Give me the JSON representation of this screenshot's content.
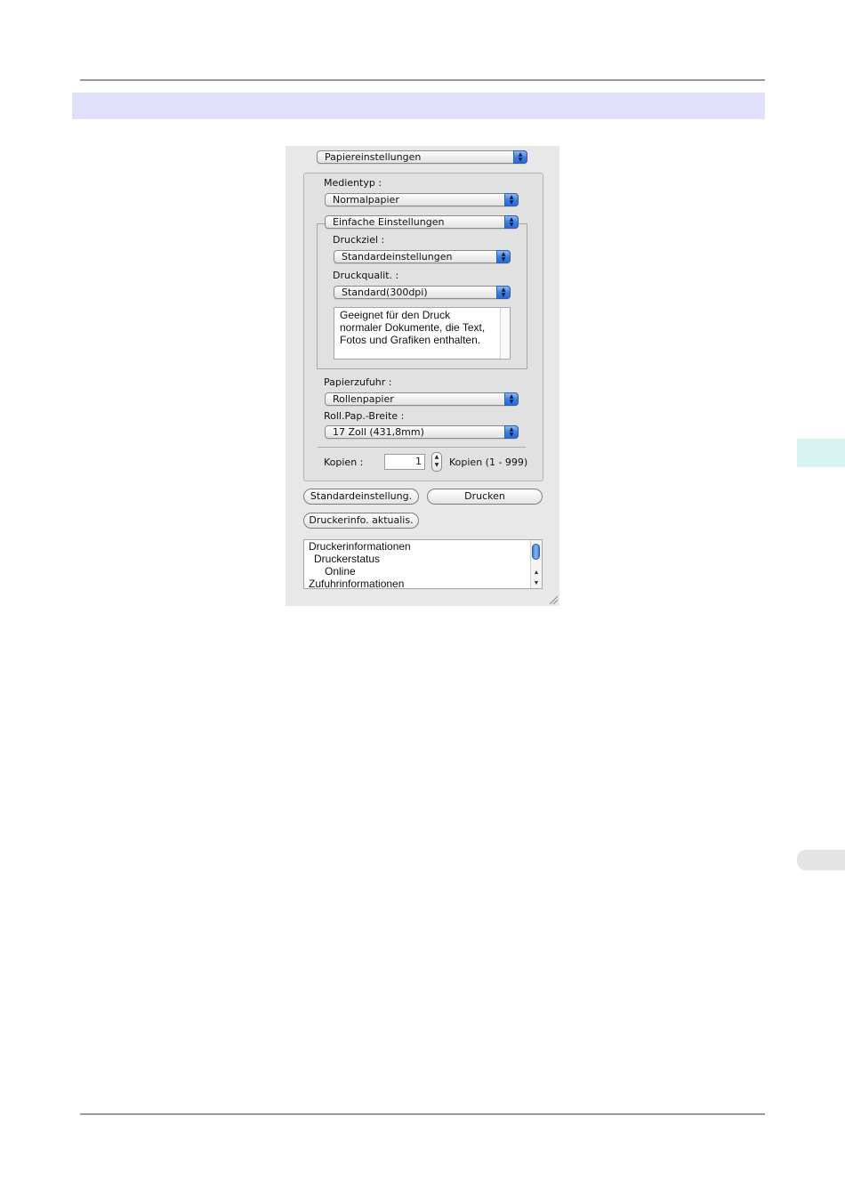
{
  "dialog": {
    "panel_popup": "Papiereinstellungen",
    "media_type": {
      "label": "Medientyp :",
      "value": "Normalpapier"
    },
    "settings_mode": "Einfache Einstellungen",
    "print_target": {
      "label": "Druckziel :",
      "value": "Standardeinstellungen"
    },
    "print_quality": {
      "label": "Druckqualit. :",
      "value": "Standard(300dpi)"
    },
    "description": [
      "Geeignet für den Druck",
      "normaler Dokumente, die Text,",
      "Fotos und Grafiken enthalten."
    ],
    "paper_source": {
      "label": "Papierzufuhr :",
      "value": "Rollenpapier"
    },
    "roll_width": {
      "label": "Roll.Pap.-Breite :",
      "value": "17 Zoll (431,8mm)"
    },
    "copies": {
      "label": "Kopien :",
      "value": "1",
      "range": "Kopien (1 - 999)"
    },
    "buttons": {
      "defaults": "Standardeinstellung.",
      "print": "Drucken",
      "refresh": "Druckerinfo. aktualis."
    },
    "printer_info": [
      "Druckerinformationen",
      "Druckerstatus",
      "Online",
      "Zufuhrinformationen"
    ]
  },
  "icons": {
    "popup_arrows": "up-down-arrows-icon",
    "stepper": "stepper-arrows-icon",
    "resize": "resize-grip-icon"
  },
  "colors": {
    "header_band": "#e0e0fb",
    "side_tab_active": "#d9f2f2",
    "side_tab_inactive": "#e4e4e4",
    "panel_bg": "#e8e8e8",
    "popup_accent": "#3f7fe0"
  }
}
